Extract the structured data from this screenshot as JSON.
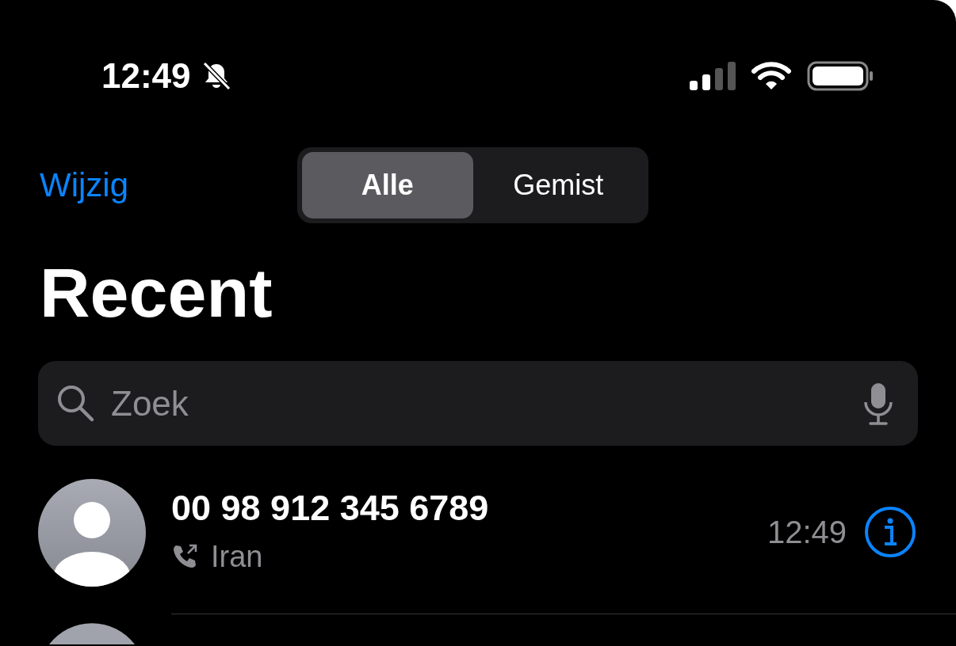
{
  "status_bar": {
    "time": "12:49"
  },
  "nav": {
    "edit": "Wijzig",
    "segments": [
      {
        "label": "Alle",
        "selected": true
      },
      {
        "label": "Gemist",
        "selected": false
      }
    ]
  },
  "title": "Recent",
  "search": {
    "placeholder": "Zoek"
  },
  "calls": [
    {
      "number": "00 98 912 345 6789",
      "kind": "outgoing",
      "location": "Iran",
      "time": "12:49"
    }
  ]
}
